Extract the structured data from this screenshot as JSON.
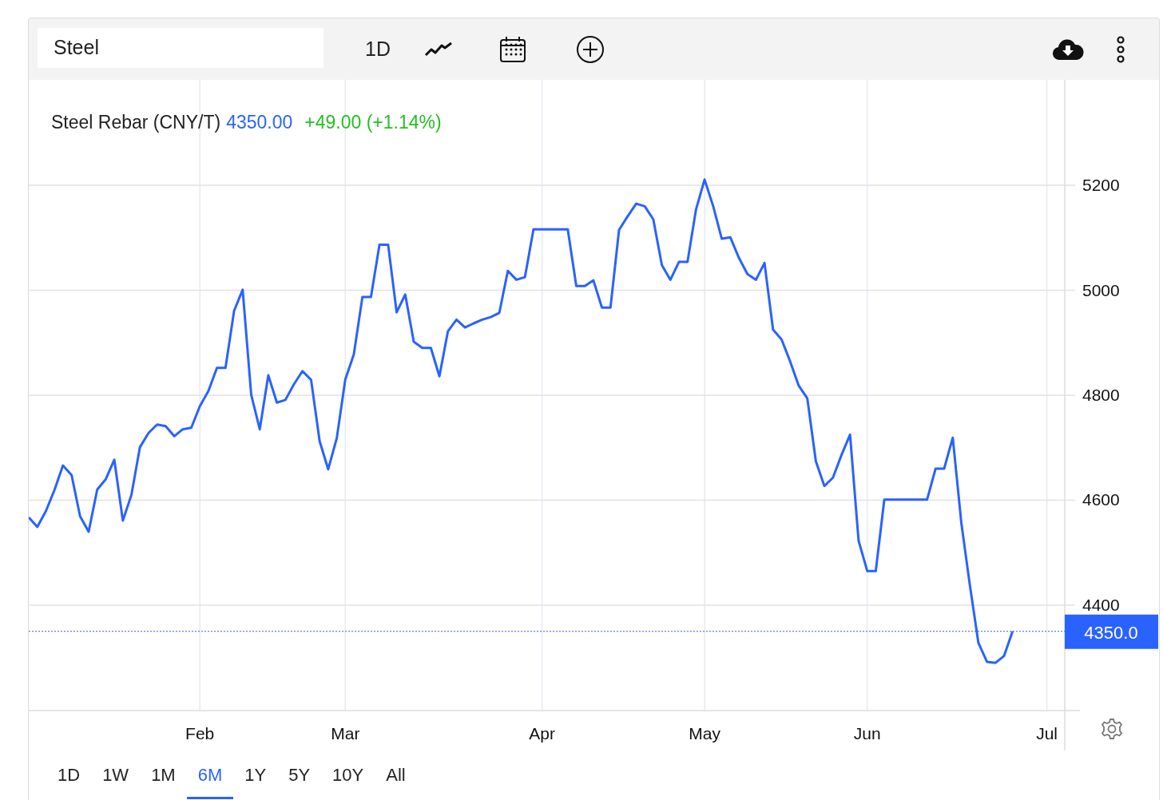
{
  "toolbar": {
    "search": {
      "value": "Steel"
    },
    "interval": "1D"
  },
  "chart": {
    "legend": {
      "price": "4350.00",
      "change": "+49.00 (+1.14%)"
    },
    "chart_data": {
      "type": "line",
      "grid": true,
      "ylim": [
        4199,
        5401
      ],
      "ref_lines": [
        {
          "axis": "y",
          "value": 4350,
          "label": "4350.0",
          "color": "#2962ff"
        }
      ],
      "categories": [
        null,
        null,
        null,
        null,
        null,
        null,
        null,
        null,
        null,
        null,
        null,
        null,
        null,
        null,
        null,
        null,
        null,
        null,
        null,
        null,
        "Feb",
        null,
        null,
        null,
        null,
        null,
        null,
        null,
        null,
        null,
        null,
        null,
        null,
        null,
        null,
        null,
        null,
        "Mar",
        null,
        null,
        null,
        null,
        null,
        null,
        null,
        null,
        null,
        null,
        null,
        null,
        null,
        null,
        null,
        null,
        null,
        null,
        null,
        null,
        null,
        null,
        "Apr",
        null,
        null,
        null,
        null,
        null,
        null,
        null,
        null,
        null,
        null,
        null,
        null,
        null,
        null,
        null,
        null,
        null,
        null,
        "May",
        null,
        null,
        null,
        null,
        null,
        null,
        null,
        null,
        null,
        null,
        null,
        null,
        null,
        null,
        null,
        null,
        null,
        null,
        "Jun",
        null,
        null,
        null,
        null,
        null,
        null,
        null,
        null,
        null,
        null,
        null,
        null,
        null,
        null,
        null,
        null,
        null,
        null,
        null,
        null,
        "Jul",
        null
      ],
      "yticks": [
        4400,
        4600,
        4800,
        5000,
        5200
      ],
      "series": [
        {
          "name": "Steel Rebar (CNY/T)",
          "color": "#2962ff",
          "values": [
            4567,
            4549,
            4579,
            4619,
            4666,
            4648,
            4569,
            4540,
            4620,
            4640,
            4677,
            4561,
            4610,
            4701,
            4728,
            4744,
            4741,
            4722,
            4735,
            4738,
            4779,
            4808,
            4852,
            4852,
            4961,
            5001,
            4801,
            4735,
            4838,
            4786,
            4791,
            4821,
            4846,
            4829,
            4712,
            4659,
            4718,
            4830,
            4878,
            4987,
            4987,
            5087,
            5087,
            4958,
            4992,
            4902,
            4890,
            4890,
            4836,
            4922,
            4944,
            4929,
            4937,
            4944,
            4949,
            4957,
            5037,
            5020,
            5025,
            5116,
            5116,
            5116,
            5116,
            5116,
            5008,
            5008,
            5019,
            4967,
            4967,
            5115,
            5141,
            5165,
            5160,
            5135,
            5048,
            5020,
            5054,
            5054,
            5154,
            5211,
            5160,
            5098,
            5101,
            5062,
            5031,
            5020,
            5052,
            4925,
            4906,
            4864,
            4818,
            4794,
            4674,
            4627,
            4643,
            4686,
            4725,
            4523,
            4465,
            4465,
            4601,
            4601,
            4601,
            4601,
            4601,
            4601,
            4660,
            4660,
            4719,
            4557,
            4438,
            4328,
            4292,
            4290,
            4303,
            4350,
            null,
            null,
            null,
            null,
            null
          ]
        }
      ]
    }
  },
  "ranges": [
    {
      "label": "1D",
      "selected": false
    },
    {
      "label": "1W",
      "selected": false
    },
    {
      "label": "1M",
      "selected": false
    },
    {
      "label": "6M",
      "selected": true
    },
    {
      "label": "1Y",
      "selected": false
    },
    {
      "label": "5Y",
      "selected": false
    },
    {
      "label": "10Y",
      "selected": false
    },
    {
      "label": "All",
      "selected": false
    }
  ]
}
